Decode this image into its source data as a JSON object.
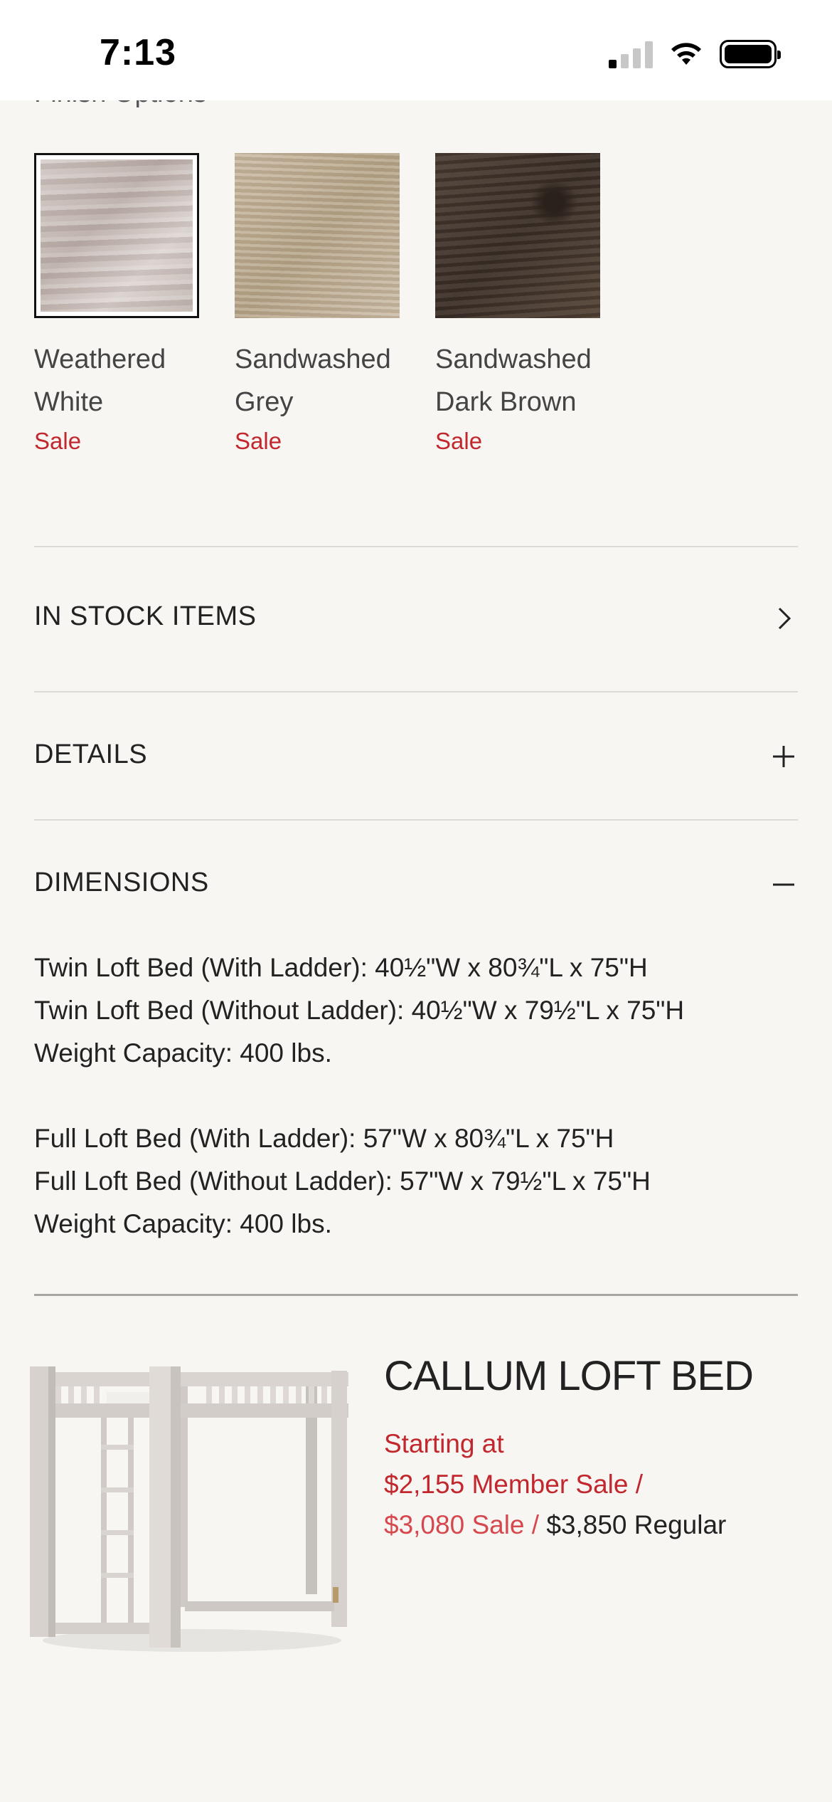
{
  "status_bar": {
    "time": "7:13"
  },
  "finish_options": {
    "heading": "Finish Options",
    "swatches": [
      {
        "name_line1": "Weathered",
        "name_line2": "White",
        "badge": "Sale",
        "selected": true
      },
      {
        "name_line1": "Sandwashed",
        "name_line2": "Grey",
        "badge": "Sale",
        "selected": false
      },
      {
        "name_line1": "Sandwashed",
        "name_line2": "Dark Brown",
        "badge": "Sale",
        "selected": false
      }
    ]
  },
  "sections": {
    "in_stock": "IN STOCK ITEMS",
    "details": "DETAILS",
    "dimensions": "DIMENSIONS"
  },
  "dimensions": {
    "twin_with": "Twin Loft Bed (With Ladder): 40½\"W x 80¾\"L x 75\"H",
    "twin_without": "Twin Loft Bed (Without Ladder): 40½\"W x 79½\"L x 75\"H",
    "twin_weight": "Weight Capacity: 400 lbs.",
    "full_with": "Full Loft Bed (With Ladder): 57\"W x 80¾\"L x 75\"H",
    "full_without": "Full Loft Bed (Without Ladder): 57\"W x 79½\"L x 75\"H",
    "full_weight": "Weight Capacity: 400 lbs."
  },
  "product": {
    "title": "CALLUM LOFT BED",
    "starting_at": "Starting at",
    "member_price": "$2,155 Member Sale /",
    "sale_price": "$3,080 Sale /",
    "regular_price": "$3,850 Regular"
  },
  "colors": {
    "sale_red": "#c1272d",
    "background": "#f7f6f3"
  }
}
